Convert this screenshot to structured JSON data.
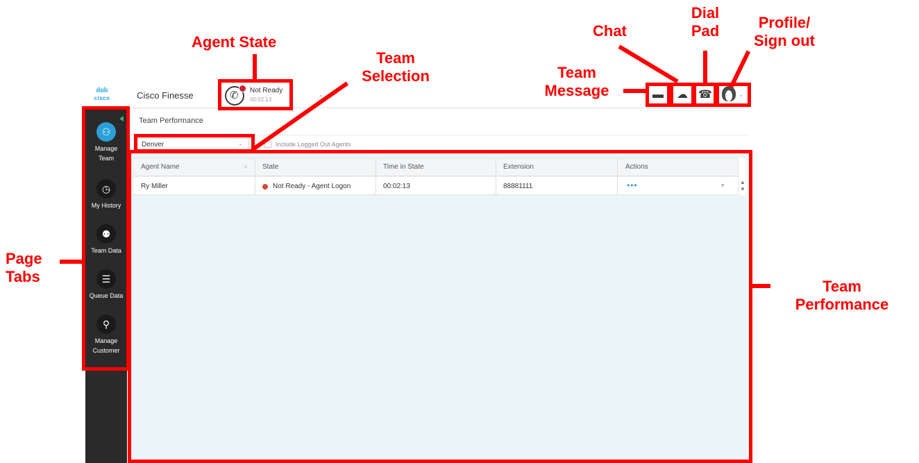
{
  "app": {
    "logo_text": "cisco",
    "logo_bars": "ılıılı",
    "title": "Cisco Finesse"
  },
  "agent_state": {
    "label": "Not Ready",
    "timer": "00:02:13",
    "status_color": "#cf2030"
  },
  "sidebar": {
    "items": [
      {
        "label_line1": "Manage",
        "label_line2": "Team",
        "icon": "manage-team-icon",
        "active": true
      },
      {
        "label_line1": "My History",
        "label_line2": "",
        "icon": "history-icon",
        "active": false
      },
      {
        "label_line1": "Team Data",
        "label_line2": "",
        "icon": "team-data-icon",
        "active": false
      },
      {
        "label_line1": "Queue Data",
        "label_line2": "",
        "icon": "queue-data-icon",
        "active": false
      },
      {
        "label_line1": "Manage",
        "label_line2": "Customer",
        "icon": "manage-customer-icon",
        "active": false
      }
    ]
  },
  "gadget": {
    "title": "Team Performance",
    "team_select_value": "Denver",
    "include_logged_out_label": "Include Logged Out Agents",
    "columns": [
      "Agent Name",
      "State",
      "Time in State",
      "Extension",
      "Actions"
    ],
    "rows": [
      {
        "agent_name": "Ry Miller",
        "state": "Not Ready - Agent Logon",
        "time_in_state": "00:02:13",
        "extension": "88881111",
        "actions": "•••"
      }
    ]
  },
  "annotations": {
    "agent_state": "Agent State",
    "team_selection_line1": "Team",
    "team_selection_line2": "Selection",
    "team_message_line1": "Team",
    "team_message_line2": "Message",
    "chat": "Chat",
    "dial_pad_line1": "Dial",
    "dial_pad_line2": "Pad",
    "profile_line1": "Profile/",
    "profile_line2": "Sign out",
    "page_tabs_line1": "Page",
    "page_tabs_line2": "Tabs",
    "team_performance_line1": "Team",
    "team_performance_line2": "Performance",
    "color": "#ff0000"
  }
}
